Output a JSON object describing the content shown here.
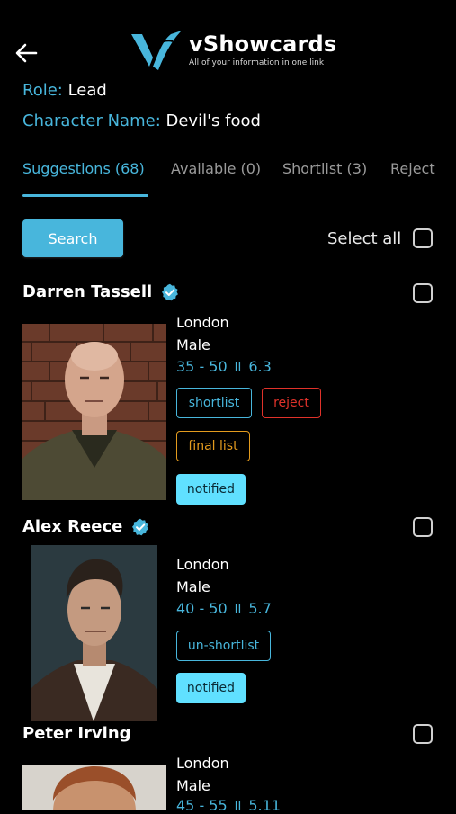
{
  "header": {
    "back_icon": "arrow-left-icon",
    "logo_title": "vShowcards",
    "logo_tagline": "All of your information in one link",
    "logo_color": "#48b6dc"
  },
  "role": {
    "label": "Role:",
    "value": "Lead"
  },
  "character": {
    "label": "Character Name:",
    "value": "Devil's food"
  },
  "tabs": [
    {
      "label": "Suggestions (68)",
      "active": true
    },
    {
      "label": "Available (0)",
      "active": false
    },
    {
      "label": "Shortlist (3)",
      "active": false
    },
    {
      "label": "Reject",
      "active": false
    }
  ],
  "actions": {
    "search_label": "Search",
    "select_all_label": "Select all"
  },
  "separator": "II",
  "candidates": [
    {
      "name": "Darren Tassell",
      "verified": true,
      "location": "London",
      "gender": "Male",
      "age_range": "35 - 50",
      "height": "6.3",
      "buttons": [
        "shortlist",
        "reject",
        "final list",
        "notified"
      ]
    },
    {
      "name": "Alex Reece",
      "verified": true,
      "location": "London",
      "gender": "Male",
      "age_range": "40 - 50",
      "height": "5.7",
      "buttons": [
        "un-shortlist",
        "notified"
      ]
    },
    {
      "name": "Peter Irving",
      "verified": false,
      "location": "London",
      "gender": "Male",
      "age_range": "45 - 55",
      "height": "5.11",
      "buttons": []
    }
  ],
  "colors": {
    "accent": "#48b6dc",
    "reject": "#e0322a",
    "final_list": "#e39b1e",
    "notified_fill": "#60e0ff",
    "background": "#000000"
  }
}
